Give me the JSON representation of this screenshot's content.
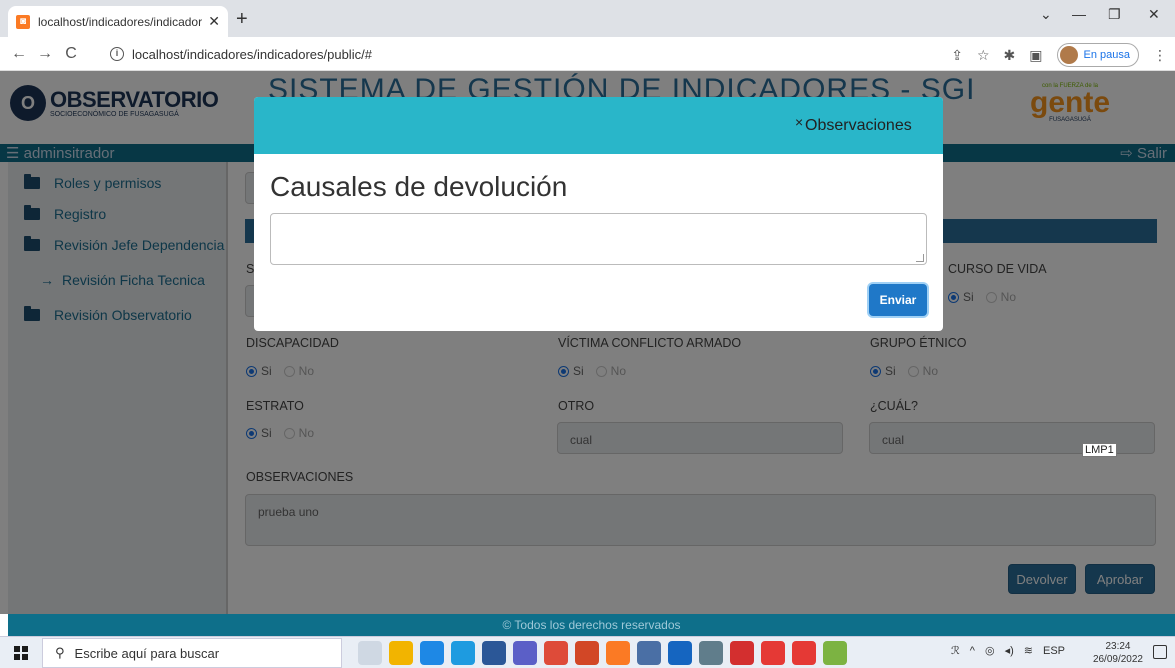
{
  "browser": {
    "tab_title": "localhost/indicadores/indicadore",
    "url": "localhost/indicadores/indicadores/public/#",
    "profile_label": "En pausa"
  },
  "header": {
    "logo_left_line1": "OBSERVATORIO",
    "logo_left_line2": "SOCIOECONÓMICO DE FUSAGASUGÁ",
    "site_title": "SISTEMA DE GESTIÓN DE INDICADORES - SGI",
    "logo_right_line1": "con la FUERZA de la",
    "logo_right_line2": "gente",
    "logo_right_line3": "FUSAGASUGÁ"
  },
  "appnav": {
    "user": "adminsitrador",
    "logout": "Salir"
  },
  "sidebar": {
    "items": [
      {
        "label": "Roles y permisos"
      },
      {
        "label": "Registro"
      },
      {
        "label": "Revisión Jefe Dependencia"
      },
      {
        "label": "Revisión Ficha Tecnica"
      },
      {
        "label": "Revisión Observatorio"
      }
    ]
  },
  "form": {
    "curso_de_vida": "CURSO DE VIDA",
    "discapacidad": "DISCAPACIDAD",
    "victima": "VÍCTIMA CONFLICTO ARMADO",
    "grupo_etnico": "GRUPO ÉTNICO",
    "estrato": "ESTRATO",
    "otro": "OTRO",
    "cual": "¿CUÁL?",
    "otro_value": "cual",
    "cual_value": "cual",
    "observaciones": "OBSERVACIONES",
    "observaciones_value": "prueba uno",
    "opt_si": "Si",
    "opt_no": "No",
    "btn_devolver": "Devolver",
    "btn_aprobar": "Aprobar",
    "partial_s": "S"
  },
  "modal": {
    "close": "×",
    "header_title": "Observaciones",
    "heading": "Causales de devolución",
    "textarea_value": "",
    "send": "Enviar"
  },
  "footer": {
    "text": "© Todos los derechos reservados"
  },
  "tooltip": "LMP1",
  "taskbar": {
    "search_placeholder": "Escribe aquí para buscar",
    "lang": "ESP",
    "time": "23:24",
    "date": "26/09/2022"
  }
}
